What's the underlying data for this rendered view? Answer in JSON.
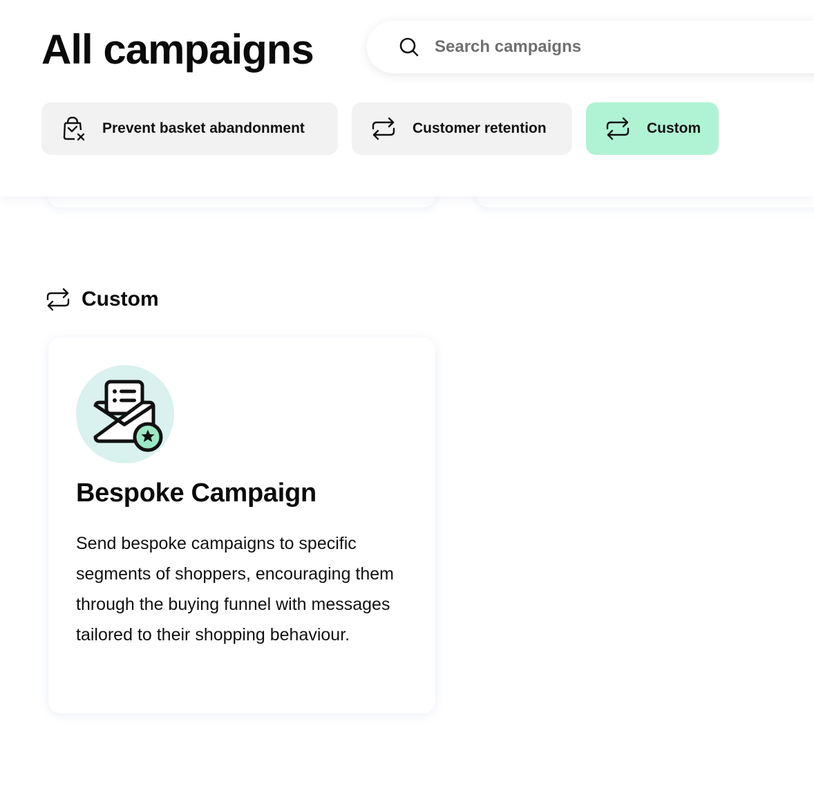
{
  "header": {
    "title": "All campaigns",
    "search": {
      "placeholder": "Search campaigns",
      "value": "",
      "icon": "search-icon"
    }
  },
  "filters": [
    {
      "label": "Prevent basket abandonment",
      "icon": "basket-x-icon",
      "active": false
    },
    {
      "label": "Customer retention",
      "icon": "repeat-arrows-icon",
      "active": false
    },
    {
      "label": "Custom",
      "icon": "repeat-arrows-icon",
      "active": true
    }
  ],
  "section": {
    "title": "Custom",
    "icon": "repeat-arrows-icon",
    "cards": [
      {
        "title": "Bespoke Campaign",
        "description": "Send bespoke campaigns to specific segments of shoppers, encouraging them through the buying funnel with messages tailored to their shopping behaviour.",
        "icon": "envelope-star-icon"
      }
    ]
  },
  "colors": {
    "active_chip": "#b0f3d4",
    "chip": "#f2f2f2",
    "badge_bg": "#d9f1ef",
    "star_badge": "#9be8c4"
  }
}
